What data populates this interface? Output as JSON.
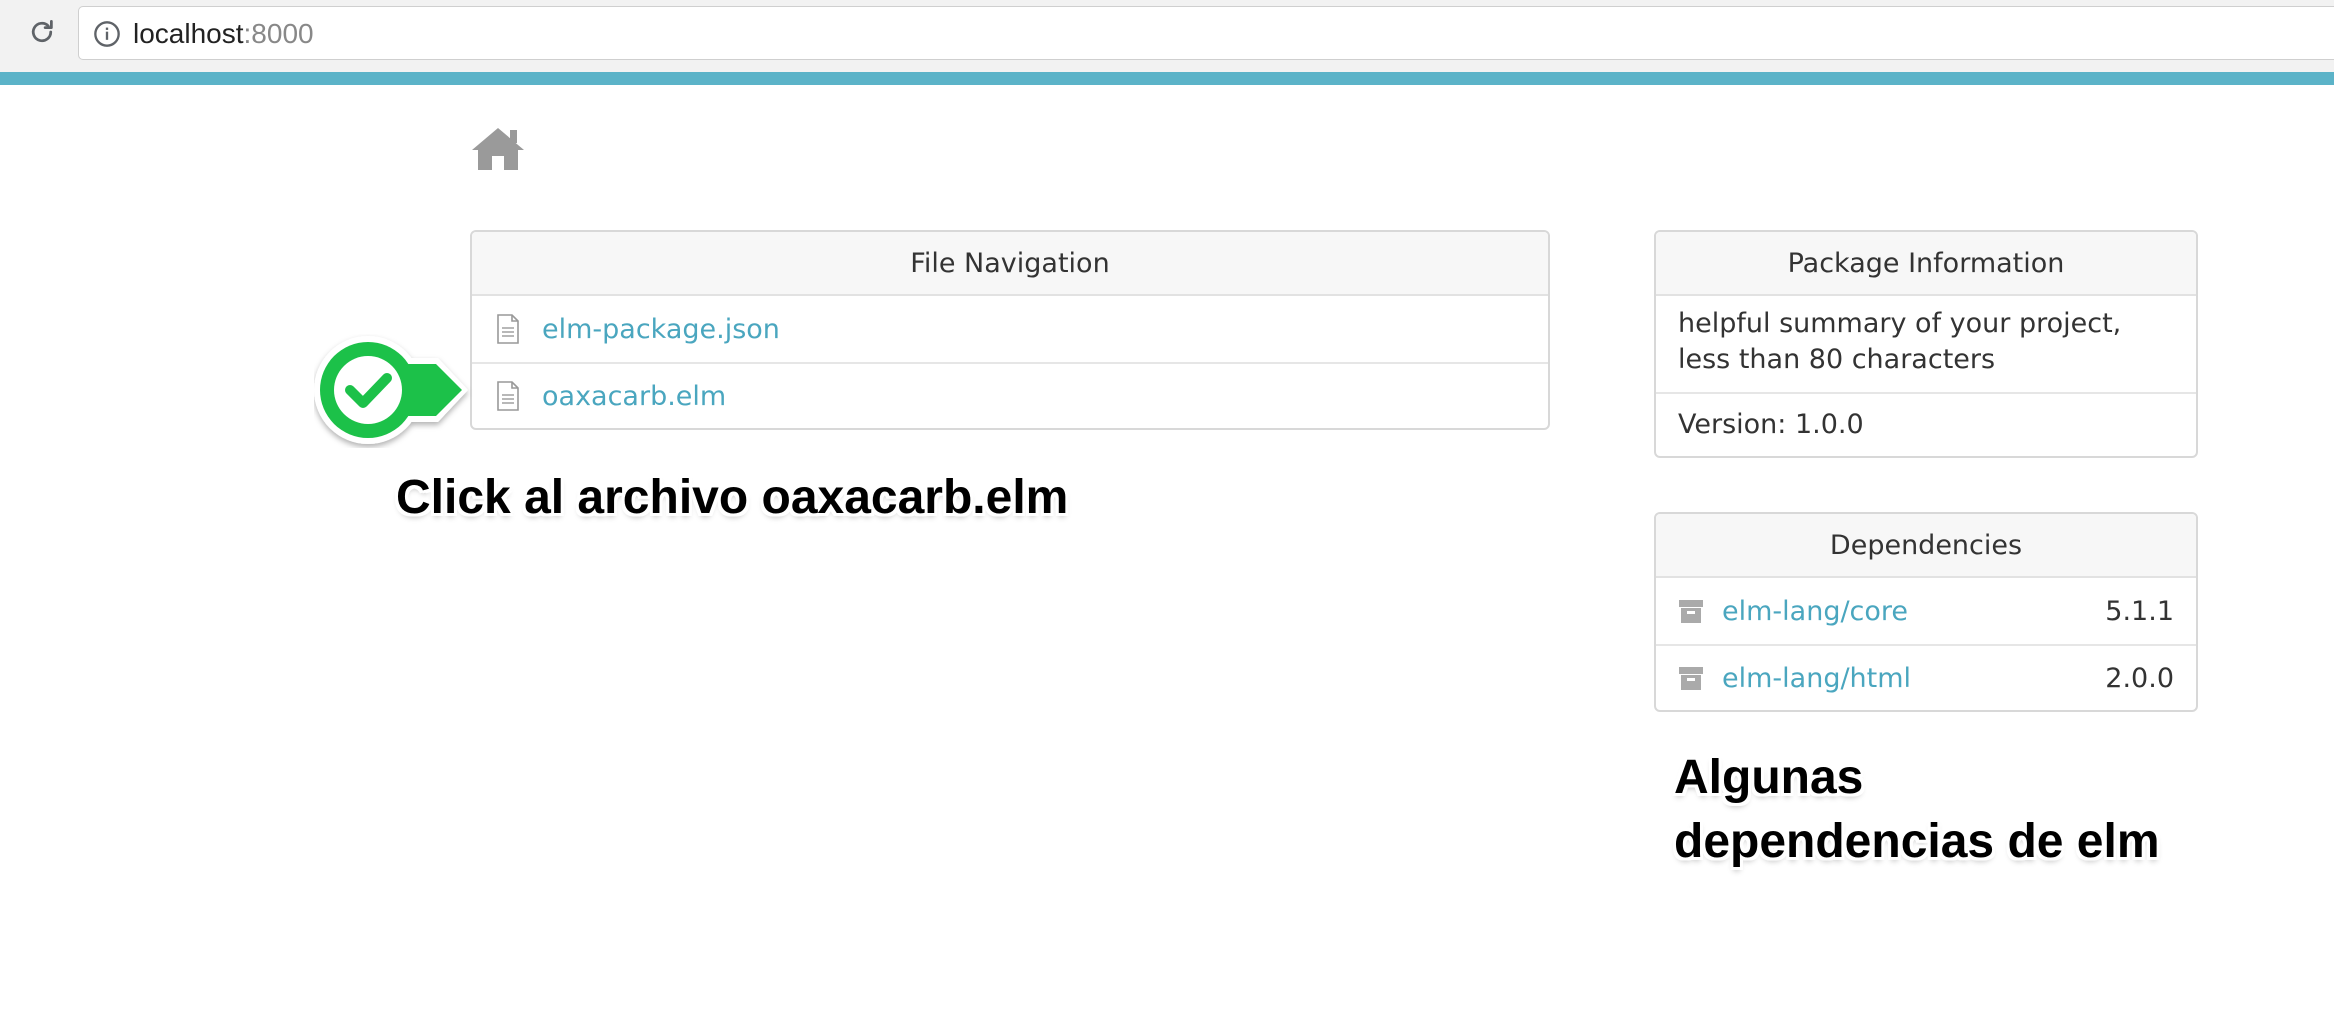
{
  "browser": {
    "url_host": "localhost",
    "url_port": ":8000"
  },
  "file_navigation": {
    "title": "File Navigation",
    "files": [
      {
        "name": "elm-package.json"
      },
      {
        "name": "oaxacarb.elm"
      }
    ]
  },
  "package_information": {
    "title": "Package Information",
    "summary": "helpful summary of your project, less than 80 characters",
    "version": "Version: 1.0.0"
  },
  "dependencies": {
    "title": "Dependencies",
    "items": [
      {
        "name": "elm-lang/core",
        "version": "5.1.1"
      },
      {
        "name": "elm-lang/html",
        "version": "2.0.0"
      }
    ]
  },
  "annotations": {
    "click_hint": "Click al archivo oaxacarb.elm",
    "deps_hint": "Algunas dependencias de elm"
  },
  "colors": {
    "accent_bar": "#5bb3c8",
    "link": "#4aa6bf",
    "badge_green": "#1ec14a"
  }
}
